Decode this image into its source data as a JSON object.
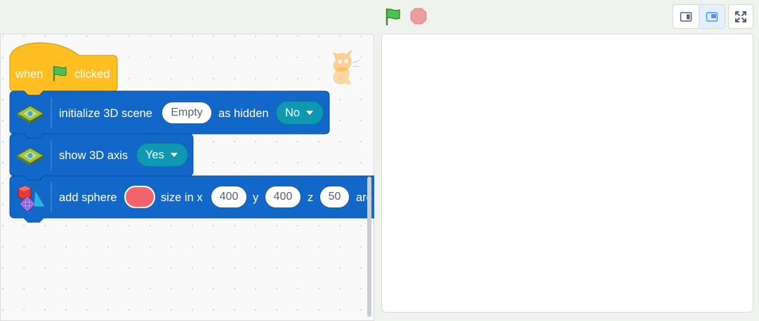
{
  "toolbar": {
    "green_flag": "green-flag-icon",
    "stop": "stop-icon",
    "small_stage": "small-stage-icon",
    "large_stage": "large-stage-icon",
    "fullscreen": "fullscreen-icon"
  },
  "blocks": {
    "hat": {
      "when": "when",
      "clicked": "clicked"
    },
    "init_scene": {
      "label": "initialize 3D scene",
      "scene_value": "Empty",
      "hidden_label": "as hidden",
      "hidden_value": "No"
    },
    "show_axis": {
      "label": "show 3D axis",
      "value": "Yes"
    },
    "add_sphere": {
      "label": "add sphere",
      "color": "#f2636b",
      "size_label": "size in x",
      "x": "400",
      "y_label": "y",
      "y": "400",
      "z_label": "z",
      "z": "50",
      "tail": "arc"
    }
  },
  "colors": {
    "hat": "#ffbf22",
    "extension": "#1168c9",
    "dropdown": "#0e98b2",
    "swatch": "#f2636b"
  }
}
